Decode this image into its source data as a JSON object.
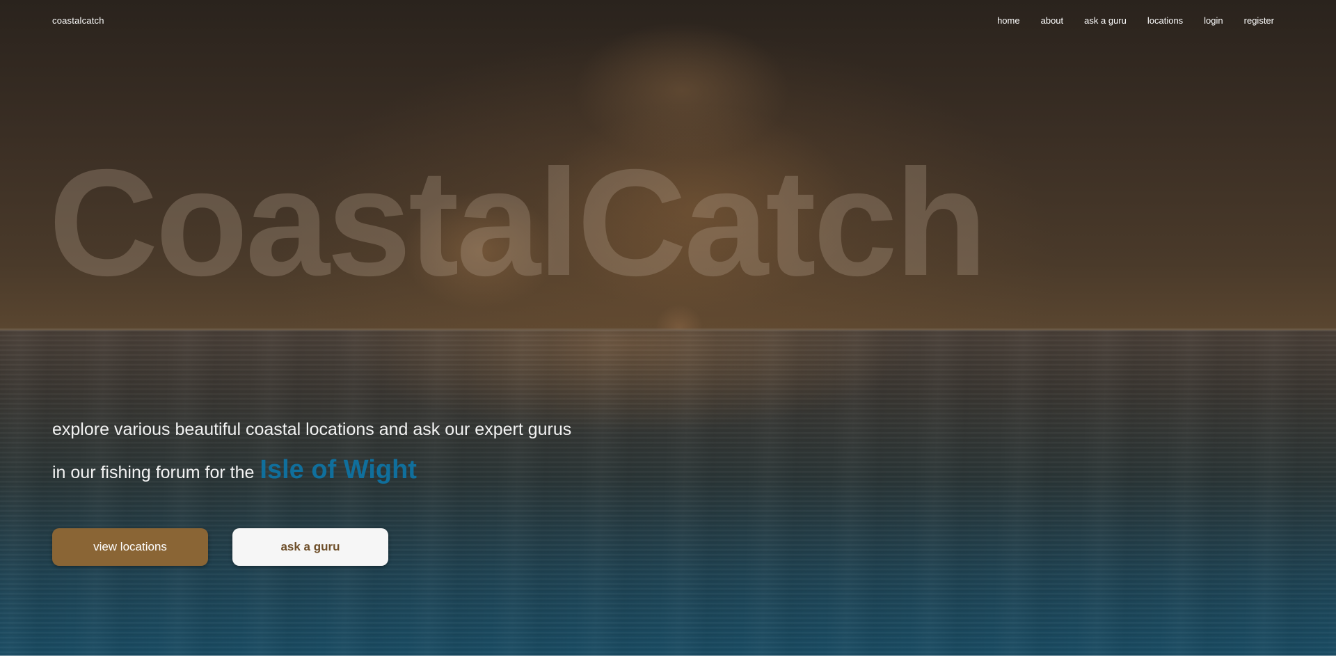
{
  "header": {
    "brand": "coastalcatch",
    "nav": [
      "home",
      "about",
      "ask a guru",
      "locations",
      "login",
      "register"
    ]
  },
  "hero": {
    "title": "CoastalCatch",
    "tagline_line1": "explore various beautiful coastal locations and ask our expert gurus",
    "tagline_line2_prefix": "in our fishing forum for the",
    "tagline_highlight": "Isle of Wight",
    "primary_button": "view locations",
    "secondary_button": "ask a guru"
  },
  "colors": {
    "accent_brown": "#8a6535",
    "highlight_blue": "#106f9c",
    "button_light": "#f6f6f6"
  }
}
